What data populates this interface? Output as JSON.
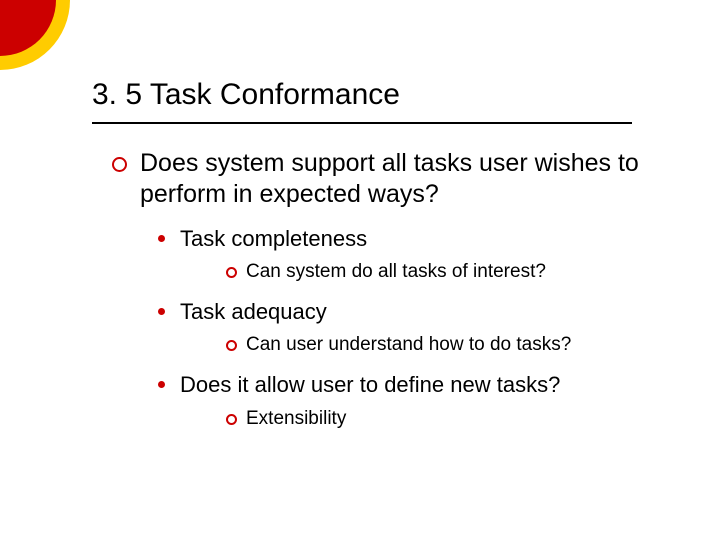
{
  "title": "3. 5 Task Conformance",
  "body": [
    {
      "text": "Does system support all tasks user wishes to perform in expected ways?",
      "children": [
        {
          "text": "Task completeness",
          "children": [
            {
              "text": "Can system do all tasks of interest?"
            }
          ]
        },
        {
          "text": "Task adequacy",
          "children": [
            {
              "text": "Can user understand how to do tasks?"
            }
          ]
        },
        {
          "text": "Does it allow user to define new tasks?",
          "children": [
            {
              "text": "Extensibility"
            }
          ]
        }
      ]
    }
  ],
  "colors": {
    "accent": "#cc0000",
    "secondary": "#ffcc00"
  }
}
